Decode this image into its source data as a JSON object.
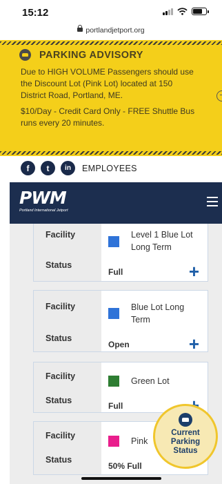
{
  "status_bar": {
    "time": "15:12"
  },
  "browser": {
    "url": "portlandjetport.org"
  },
  "advisory": {
    "title": "PARKING ADVISORY",
    "body1": "Due to HIGH VOLUME Passengers should use the Discount Lot (Pink Lot) located at 150 District Road, Portland, ME.",
    "body2": "$10/Day - Credit Card Only - FREE Shuttle Bus runs every 20 minutes."
  },
  "social": {
    "facebook": "f",
    "twitter": "t",
    "linkedin": "in",
    "employees_label": "EMPLOYEES"
  },
  "header": {
    "logo_text": "PWM",
    "logo_sub": "Portland International Jetport"
  },
  "parking": {
    "facility_label": "Facility",
    "status_label": "Status",
    "cards": [
      {
        "name": "Level 1 Blue Lot Long Term",
        "status": "Full",
        "color": "#2f73d8"
      },
      {
        "name": "Blue Lot Long Term",
        "status": "Open",
        "color": "#2f73d8"
      },
      {
        "name": "Green Lot",
        "status": "Full",
        "color": "#2e7d32"
      },
      {
        "name": "Pink",
        "status": "50% Full",
        "color": "#e91e8c"
      }
    ]
  },
  "current_status_button": {
    "line1": "Current",
    "line2": "Parking",
    "line3": "Status"
  }
}
